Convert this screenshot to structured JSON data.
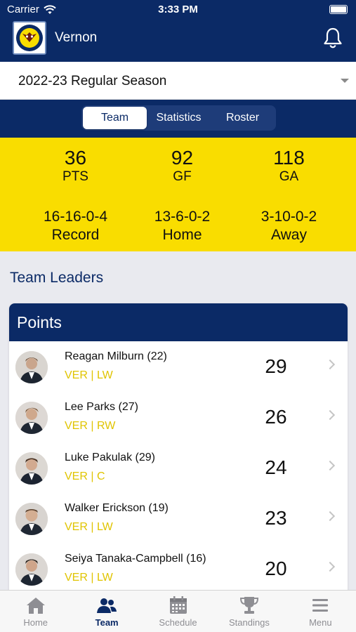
{
  "status_bar": {
    "carrier": "Carrier",
    "time": "3:33 PM"
  },
  "header": {
    "team_name": "Vernon"
  },
  "season": {
    "selected": "2022-23 Regular Season"
  },
  "tabs": [
    {
      "label": "Team",
      "active": true
    },
    {
      "label": "Statistics",
      "active": false
    },
    {
      "label": "Roster",
      "active": false
    }
  ],
  "stats": {
    "pts": {
      "value": "36",
      "label": "PTS"
    },
    "gf": {
      "value": "92",
      "label": "GF"
    },
    "ga": {
      "value": "118",
      "label": "GA"
    },
    "record": {
      "value": "16-16-0-4",
      "label": "Record"
    },
    "home": {
      "value": "13-6-0-2",
      "label": "Home"
    },
    "away": {
      "value": "3-10-0-2",
      "label": "Away"
    }
  },
  "team_leaders": {
    "title": "Team Leaders",
    "points": {
      "header": "Points",
      "players": [
        {
          "name": "Reagan Milburn (22)",
          "team_pos": "VER | LW",
          "value": "29"
        },
        {
          "name": "Lee Parks (27)",
          "team_pos": "VER | RW",
          "value": "26"
        },
        {
          "name": "Luke Pakulak (29)",
          "team_pos": "VER | C",
          "value": "24"
        },
        {
          "name": "Walker Erickson (19)",
          "team_pos": "VER | LW",
          "value": "23"
        },
        {
          "name": "Seiya Tanaka-Campbell (16)",
          "team_pos": "VER | LW",
          "value": "20"
        }
      ]
    }
  },
  "bottom_nav": [
    {
      "label": "Home",
      "icon": "home-icon",
      "active": false
    },
    {
      "label": "Team",
      "icon": "team-icon",
      "active": true
    },
    {
      "label": "Schedule",
      "icon": "calendar-icon",
      "active": false
    },
    {
      "label": "Standings",
      "icon": "trophy-icon",
      "active": false
    },
    {
      "label": "Menu",
      "icon": "menu-icon",
      "active": false
    }
  ],
  "colors": {
    "navy": "#0b2a66",
    "yellow": "#f9dd00",
    "accent_text": "#e0c400"
  }
}
